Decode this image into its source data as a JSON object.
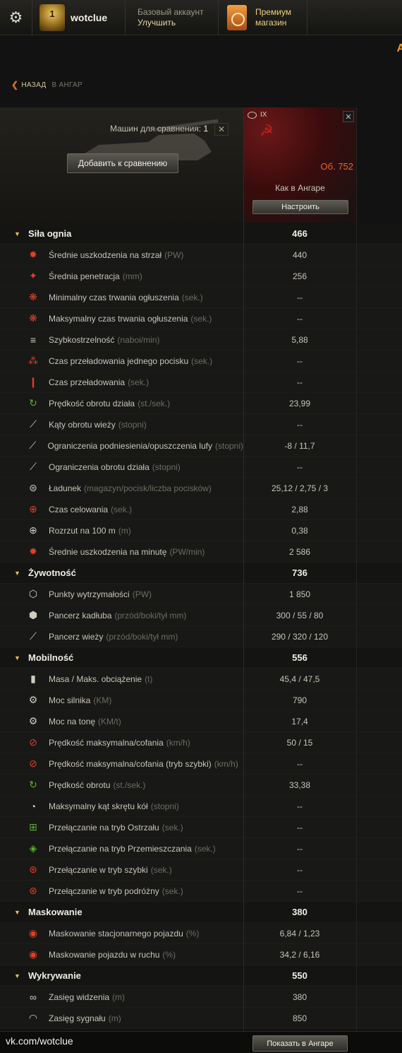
{
  "topbar": {
    "trophy_badge": "1",
    "username": "wotclue",
    "account_type": "Базовый аккаунт",
    "upgrade": "Улучшить",
    "premium_line1": "Премиум",
    "premium_line2": "магазин",
    "edge_letter": "A"
  },
  "breadcrumb": {
    "back": "НАЗАД",
    "location": "В АНГАР"
  },
  "compare": {
    "count_label": "Машин для сравнения:",
    "count": "1",
    "add_button": "Добавить к сравнению"
  },
  "tank": {
    "tier": "IX",
    "name": "Об. 752",
    "setup_label": "Как в Ангаре",
    "config_button": "Настроить"
  },
  "rows": [
    {
      "type": "category",
      "name": "Siła ognia",
      "value": "466"
    },
    {
      "type": "stat",
      "icon": "damage-icon",
      "glyph": "✸",
      "tone": "red",
      "name": "Średnie uszkodzenia na strzał",
      "unit": "(PW)",
      "value": "440"
    },
    {
      "type": "stat",
      "icon": "penetration-icon",
      "glyph": "✦",
      "tone": "red",
      "name": "Średnia penetracja",
      "unit": "(mm)",
      "value": "256"
    },
    {
      "type": "stat",
      "icon": "stun-min-icon",
      "glyph": "❋",
      "tone": "red",
      "name": "Minimalny czas trwania ogłuszenia",
      "unit": "(sek.)",
      "value": "--"
    },
    {
      "type": "stat",
      "icon": "stun-max-icon",
      "glyph": "❋",
      "tone": "red",
      "name": "Maksymalny czas trwania ogłuszenia",
      "unit": "(sek.)",
      "value": "--"
    },
    {
      "type": "stat",
      "icon": "rate-of-fire-icon",
      "glyph": "≡",
      "tone": "",
      "name": "Szybkostrzelność",
      "unit": "(naboi/min)",
      "value": "5,88"
    },
    {
      "type": "stat",
      "icon": "shell-reload-icon",
      "glyph": "⁂",
      "tone": "red",
      "name": "Czas przeładowania jednego pocisku",
      "unit": "(sek.)",
      "value": "--"
    },
    {
      "type": "stat",
      "icon": "reload-icon",
      "glyph": "❙",
      "tone": "red",
      "name": "Czas przeładowania",
      "unit": "(sek.)",
      "value": "--"
    },
    {
      "type": "stat",
      "icon": "gun-traverse-icon",
      "glyph": "↻",
      "tone": "green",
      "name": "Prędkość obrotu działa",
      "unit": "(st./sek.)",
      "value": "23,99"
    },
    {
      "type": "stat",
      "icon": "turret-angles-icon",
      "glyph": "⟋",
      "tone": "",
      "name": "Kąty obrotu wieży",
      "unit": "(stopni)",
      "value": "--"
    },
    {
      "type": "stat",
      "icon": "elevation-icon",
      "glyph": "⟋",
      "tone": "",
      "name": "Ograniczenia podniesienia/opuszczenia lufy",
      "unit": "(stopni)",
      "value": "-8 / 11,7"
    },
    {
      "type": "stat",
      "icon": "gun-arc-icon",
      "glyph": "⟋",
      "tone": "",
      "name": "Ograniczenia obrotu działa",
      "unit": "(stopni)",
      "value": "--"
    },
    {
      "type": "stat",
      "icon": "magazine-icon",
      "glyph": "⊜",
      "tone": "",
      "name": "Ładunek",
      "unit": "(magazyn/pocisk/liczba pocisków)",
      "value": "25,12 / 2,75 / 3"
    },
    {
      "type": "stat",
      "icon": "aim-time-icon",
      "glyph": "⊕",
      "tone": "red",
      "name": "Czas celowania",
      "unit": "(sek.)",
      "value": "2,88"
    },
    {
      "type": "stat",
      "icon": "dispersion-icon",
      "glyph": "⊕",
      "tone": "",
      "name": "Rozrzut na 100 m",
      "unit": "(m)",
      "value": "0,38"
    },
    {
      "type": "stat",
      "icon": "dpm-icon",
      "glyph": "✸",
      "tone": "red",
      "name": "Średnie uszkodzenia na minutę",
      "unit": "(PW/min)",
      "value": "2 586"
    },
    {
      "type": "category",
      "name": "Żywotność",
      "value": "736"
    },
    {
      "type": "stat",
      "icon": "hitpoints-icon",
      "glyph": "⬡",
      "tone": "",
      "name": "Punkty wytrzymałości",
      "unit": "(PW)",
      "value": "1 850"
    },
    {
      "type": "stat",
      "icon": "hull-armor-icon",
      "glyph": "⬢",
      "tone": "",
      "name": "Pancerz kadłuba",
      "unit": "(przód/boki/tył mm)",
      "value": "300 / 55 / 80"
    },
    {
      "type": "stat",
      "icon": "turret-armor-icon",
      "glyph": "⟋",
      "tone": "",
      "name": "Pancerz wieży",
      "unit": "(przód/boki/tył mm)",
      "value": "290 / 320 / 120"
    },
    {
      "type": "category",
      "name": "Mobilność",
      "value": "556"
    },
    {
      "type": "stat",
      "icon": "weight-icon",
      "glyph": "▮",
      "tone": "",
      "name": "Masa / Maks. obciążenie",
      "unit": "(t)",
      "value": "45,4 / 47,5"
    },
    {
      "type": "stat",
      "icon": "engine-icon",
      "glyph": "⚙",
      "tone": "",
      "name": "Moc silnika",
      "unit": "(KM)",
      "value": "790"
    },
    {
      "type": "stat",
      "icon": "power-ratio-icon",
      "glyph": "⚙",
      "tone": "",
      "name": "Moc na tonę",
      "unit": "(KM/t)",
      "value": "17,4"
    },
    {
      "type": "stat",
      "icon": "speed-icon",
      "glyph": "⊘",
      "tone": "red",
      "name": "Prędkość maksymalna/cofania",
      "unit": "(km/h)",
      "value": "50 / 15"
    },
    {
      "type": "stat",
      "icon": "speed-fast-icon",
      "glyph": "⊘",
      "tone": "red",
      "name": "Prędkość maksymalna/cofania (tryb szybki)",
      "unit": "(km/h)",
      "value": "--"
    },
    {
      "type": "stat",
      "icon": "hull-traverse-icon",
      "glyph": "↻",
      "tone": "green",
      "name": "Prędkość obrotu",
      "unit": "(st./sek.)",
      "value": "33,38"
    },
    {
      "type": "stat",
      "icon": "wheel-angle-icon",
      "glyph": "◔",
      "tone": "",
      "name": "Maksymalny kąt skrętu kół",
      "unit": "(stopni)",
      "value": "--"
    },
    {
      "type": "stat",
      "icon": "siege-mode-icon",
      "glyph": "⊞",
      "tone": "green",
      "name": "Przełączanie na tryb Ostrzału",
      "unit": "(sek.)",
      "value": "--"
    },
    {
      "type": "stat",
      "icon": "travel-mode-icon",
      "glyph": "◈",
      "tone": "green",
      "name": "Przełączanie na tryb Przemieszczania",
      "unit": "(sek.)",
      "value": "--"
    },
    {
      "type": "stat",
      "icon": "fast-mode-icon",
      "glyph": "⊛",
      "tone": "red",
      "name": "Przełączanie w tryb szybki",
      "unit": "(sek.)",
      "value": "--"
    },
    {
      "type": "stat",
      "icon": "cruise-mode-icon",
      "glyph": "⊛",
      "tone": "red",
      "name": "Przełączanie w tryb podróżny",
      "unit": "(sek.)",
      "value": "--"
    },
    {
      "type": "category",
      "name": "Maskowanie",
      "value": "380"
    },
    {
      "type": "stat",
      "icon": "camo-still-icon",
      "glyph": "◉",
      "tone": "red",
      "name": "Maskowanie stacjonarnego pojazdu",
      "unit": "(%)",
      "value": "6,84 / 1,23"
    },
    {
      "type": "stat",
      "icon": "camo-moving-icon",
      "glyph": "◉",
      "tone": "red",
      "name": "Maskowanie pojazdu w ruchu",
      "unit": "(%)",
      "value": "34,2 / 6,16"
    },
    {
      "type": "category",
      "name": "Wykrywanie",
      "value": "550"
    },
    {
      "type": "stat",
      "icon": "view-range-icon",
      "glyph": "∞",
      "tone": "",
      "name": "Zasięg widzenia",
      "unit": "(m)",
      "value": "380"
    },
    {
      "type": "stat",
      "icon": "radio-range-icon",
      "glyph": "◠",
      "tone": "",
      "name": "Zasięg sygnału",
      "unit": "(m)",
      "value": "850"
    }
  ],
  "footer": {
    "vk_link": "vk.com/wotclue",
    "show_button": "Показать в Ангаре"
  },
  "colors": {
    "accent": "#e86a2a",
    "gold": "#e0c060",
    "background": "#121212"
  }
}
